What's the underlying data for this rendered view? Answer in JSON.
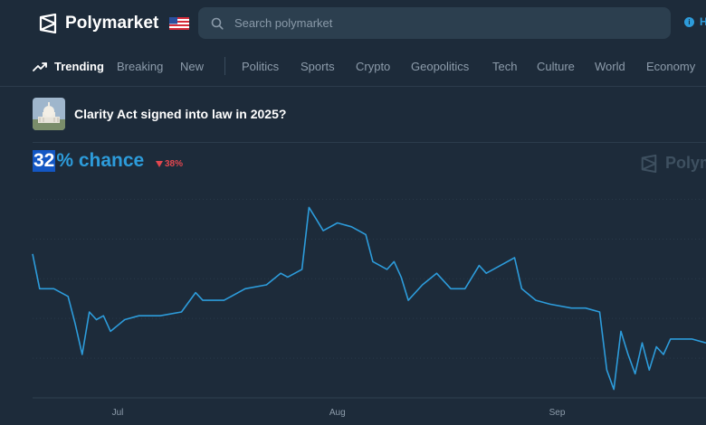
{
  "app": {
    "name": "Polymarket"
  },
  "search": {
    "placeholder": "Search polymarket"
  },
  "header": {
    "how_label": "H"
  },
  "nav": {
    "trending": "Trending",
    "breaking": "Breaking",
    "new": "New",
    "categories": [
      "Politics",
      "Sports",
      "Crypto",
      "Geopolitics",
      "Tech",
      "Culture",
      "World",
      "Economy"
    ]
  },
  "market": {
    "title": "Clarity Act signed into law in 2025?",
    "chance_value": "32",
    "chance_suffix": "% chance",
    "delta": "38%",
    "watermark": "Polym"
  },
  "colors": {
    "accent": "#2d9cdb",
    "down": "#e2474f",
    "background": "#1d2b3a"
  },
  "icons": [
    "polymarket-logo-icon",
    "us-flag-icon",
    "search-icon",
    "info-icon",
    "trending-icon",
    "triangle-down-icon"
  ],
  "chart_data": {
    "type": "line",
    "x_ticks": [
      "Jul",
      "Aug",
      "Sep"
    ],
    "ylim": [
      0,
      100
    ],
    "grid": "horizontal dotted",
    "series": [
      {
        "color": "#2d9cdb",
        "points": [
          [
            "Jun 19",
            33
          ],
          [
            "Jun 20",
            24
          ],
          [
            "Jun 22",
            24
          ],
          [
            "Jun 24",
            22
          ],
          [
            "Jun 25",
            15
          ],
          [
            "Jun 26",
            7
          ],
          [
            "Jun 27",
            18
          ],
          [
            "Jun 28",
            16
          ],
          [
            "Jun 29",
            17
          ],
          [
            "Jun 30",
            13
          ],
          [
            "Jul 2",
            16
          ],
          [
            "Jul 4",
            17
          ],
          [
            "Jul 7",
            17
          ],
          [
            "Jul 10",
            18
          ],
          [
            "Jul 12",
            23
          ],
          [
            "Jul 13",
            21
          ],
          [
            "Jul 16",
            21
          ],
          [
            "Jul 19",
            24
          ],
          [
            "Jul 22",
            25
          ],
          [
            "Jul 24",
            28
          ],
          [
            "Jul 25",
            27
          ],
          [
            "Jul 27",
            29
          ],
          [
            "Jul 28",
            45
          ],
          [
            "Jul 29",
            42
          ],
          [
            "Jul 30",
            39
          ],
          [
            "Aug 1",
            41
          ],
          [
            "Aug 3",
            40
          ],
          [
            "Aug 5",
            38
          ],
          [
            "Aug 6",
            31
          ],
          [
            "Aug 8",
            29
          ],
          [
            "Aug 9",
            31
          ],
          [
            "Aug 10",
            27
          ],
          [
            "Aug 11",
            21
          ],
          [
            "Aug 13",
            25
          ],
          [
            "Aug 15",
            28
          ],
          [
            "Aug 17",
            24
          ],
          [
            "Aug 19",
            24
          ],
          [
            "Aug 21",
            30
          ],
          [
            "Aug 22",
            28
          ],
          [
            "Aug 24",
            30
          ],
          [
            "Aug 26",
            32
          ],
          [
            "Aug 27",
            24
          ],
          [
            "Aug 29",
            21
          ],
          [
            "Aug 31",
            20
          ],
          [
            "Sep 3",
            19
          ],
          [
            "Sep 5",
            19
          ],
          [
            "Sep 7",
            18
          ],
          [
            "Sep 8",
            3
          ],
          [
            "Sep 9",
            -2
          ],
          [
            "Sep 10",
            13
          ],
          [
            "Sep 11",
            7
          ],
          [
            "Sep 12",
            2
          ],
          [
            "Sep 13",
            10
          ],
          [
            "Sep 14",
            3
          ],
          [
            "Sep 15",
            9
          ],
          [
            "Sep 16",
            7
          ],
          [
            "Sep 17",
            11
          ],
          [
            "Sep 18",
            11
          ],
          [
            "Sep 20",
            11
          ],
          [
            "Sep 22",
            10
          ]
        ]
      }
    ]
  }
}
